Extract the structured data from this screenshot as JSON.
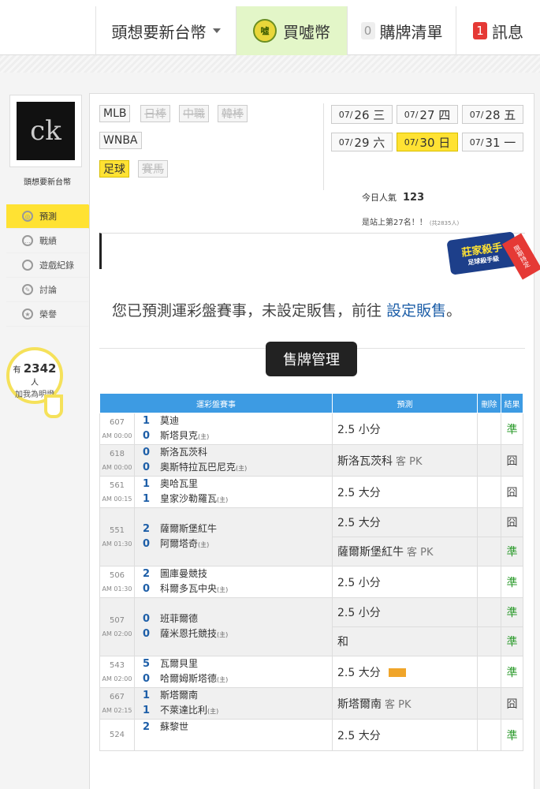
{
  "topnav": {
    "user": "頭想要新台幣",
    "buy_coin_icon_text": "噓",
    "buy": "買噓幣",
    "list_count": "0",
    "list": "購牌清單",
    "msg_count": "1",
    "msg": "訊息"
  },
  "sidebar": {
    "avatar_text": "ck",
    "username": "頭想要新台幣",
    "menu": [
      {
        "label": "預測",
        "icon": "target-icon",
        "active": true
      },
      {
        "label": "戰績",
        "icon": "chat-icon"
      },
      {
        "label": "遊戲紀錄",
        "icon": "circle-icon"
      },
      {
        "label": "討論",
        "icon": "pencil-icon"
      },
      {
        "label": "榮譽",
        "icon": "medal-icon"
      }
    ],
    "fans_prefix": "有",
    "fans_count": "2342",
    "fans_suffix": "人",
    "fans_label": "加我為明燈"
  },
  "leagues": {
    "mlb": "MLB",
    "npb": "日棒",
    "cpbl": "中職",
    "kbo": "韓棒",
    "wnba": "WNBA",
    "soccer": "足球",
    "horse": "賽馬"
  },
  "dates": [
    {
      "d": "07/",
      "day": "26 三"
    },
    {
      "d": "07/",
      "day": "27 四"
    },
    {
      "d": "07/",
      "day": "28 五"
    },
    {
      "d": "07/",
      "day": "29 六"
    },
    {
      "d": "07/",
      "day": "30 日",
      "active": true
    },
    {
      "d": "07/",
      "day": "31 一"
    }
  ],
  "stats": {
    "popularity_label": "今日人氣",
    "popularity": "123",
    "rank_text": "是站上第27名！！",
    "rank_small": "(共2835人)"
  },
  "banner": {
    "stamp_title": "莊家殺手",
    "stamp_sub": "足球殺手級",
    "ribbon": "限期持定"
  },
  "notice": {
    "text": "您已預測運彩盤賽事，未設定販售，前往",
    "link": "設定販售",
    "end": "。"
  },
  "sell_button": "售牌管理",
  "table": {
    "headers": {
      "game": "運彩盤賽事",
      "pred": "預測",
      "del": "刪除",
      "res": "結果"
    },
    "rows": [
      {
        "id": "607",
        "time": "AM 00:00",
        "s1": "1",
        "t1": "莫迪",
        "s2": "0",
        "t2": "斯塔貝克",
        "home": "(主)",
        "preds": [
          {
            "main": "2.5 小分",
            "sub": "",
            "res": "準"
          }
        ]
      },
      {
        "id": "618",
        "time": "AM 00:00",
        "s1": "0",
        "t1": "斯洛瓦茨科",
        "s2": "0",
        "t2": "奧斯特拉瓦巴尼克",
        "home": "(主)",
        "preds": [
          {
            "main": "斯洛瓦茨科",
            "sub": "客 PK",
            "res": "囧"
          }
        ]
      },
      {
        "id": "561",
        "time": "AM 00:15",
        "s1": "1",
        "t1": "奧哈瓦里",
        "s2": "1",
        "t2": "皇家沙勒羅瓦",
        "home": "(主)",
        "preds": [
          {
            "main": "2.5 大分",
            "sub": "",
            "res": "囧"
          }
        ]
      },
      {
        "id": "551",
        "time": "AM 01:30",
        "s1": "2",
        "t1": "薩爾斯堡紅牛",
        "s2": "0",
        "t2": "阿爾塔奇",
        "home": "(主)",
        "preds": [
          {
            "main": "2.5 大分",
            "sub": "",
            "res": "囧"
          },
          {
            "main": "薩爾斯堡紅牛",
            "sub": "客 PK",
            "res": "準"
          }
        ]
      },
      {
        "id": "506",
        "time": "AM 01:30",
        "s1": "2",
        "t1": "圖庫曼競技",
        "s2": "0",
        "t2": "科爾多瓦中央",
        "home": "(主)",
        "preds": [
          {
            "main": "2.5 小分",
            "sub": "",
            "res": "準"
          }
        ]
      },
      {
        "id": "507",
        "time": "AM 02:00",
        "s1": "0",
        "t1": "班菲爾德",
        "s2": "0",
        "t2": "薩米恩托競技",
        "home": "(主)",
        "preds": [
          {
            "main": "2.5 小分",
            "sub": "",
            "res": "準"
          },
          {
            "main": "和",
            "sub": "",
            "res": "準"
          }
        ]
      },
      {
        "id": "543",
        "time": "AM 02:00",
        "s1": "5",
        "t1": "瓦爾貝里",
        "s2": "0",
        "t2": "哈爾姆斯塔德",
        "home": "(主)",
        "preds": [
          {
            "main": "2.5 大分",
            "sub": "",
            "res": "準",
            "ticket": true
          }
        ]
      },
      {
        "id": "667",
        "time": "AM 02:15",
        "s1": "1",
        "t1": "斯塔爾南",
        "s2": "1",
        "t2": "不萊達比利",
        "home": "(主)",
        "preds": [
          {
            "main": "斯塔爾南",
            "sub": "客 PK",
            "res": "囧"
          }
        ]
      },
      {
        "id": "524",
        "time": "",
        "s1": "2",
        "t1": "蘇黎世",
        "s2": "",
        "t2": "",
        "home": "",
        "preds": [
          {
            "main": "2.5 大分",
            "sub": "",
            "res": "準"
          }
        ]
      }
    ]
  }
}
